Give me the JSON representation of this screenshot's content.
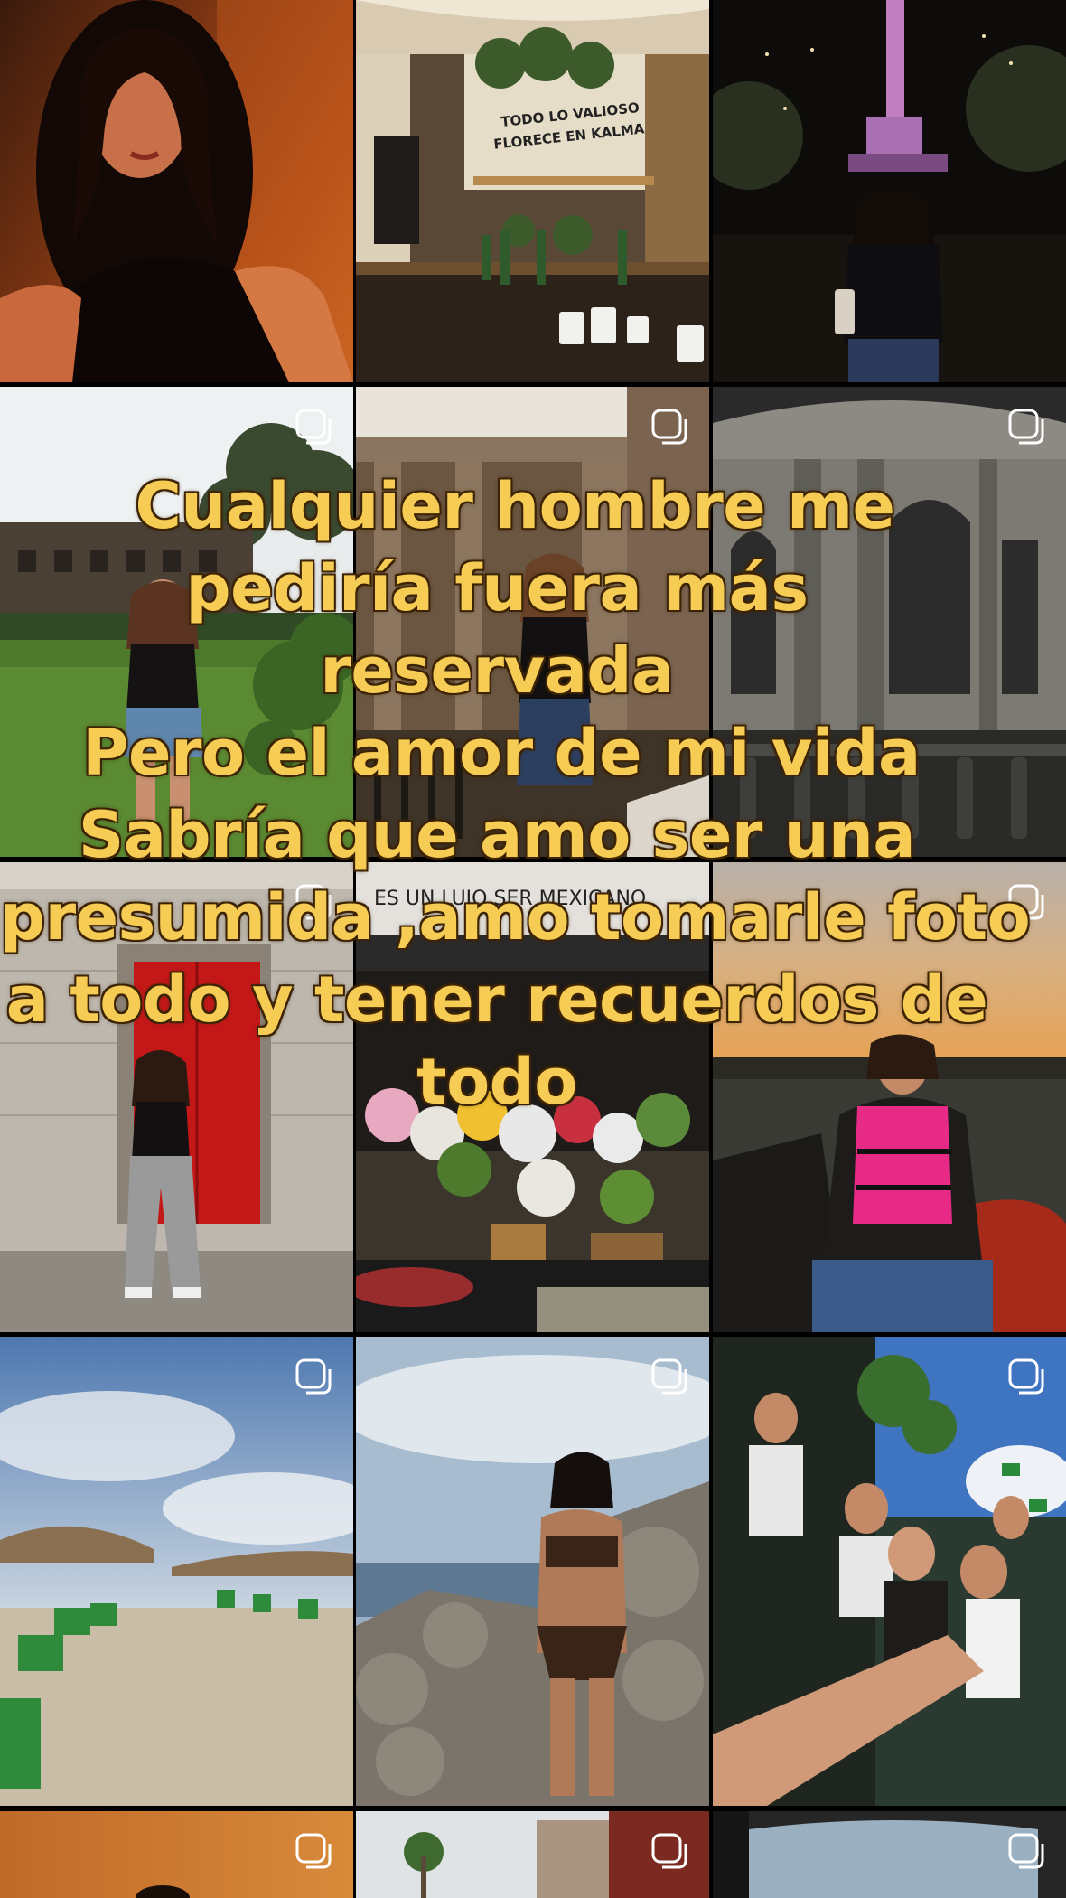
{
  "overlay_caption": {
    "lines": [
      "Cualquier hombre me",
      "pediría fuera más",
      "reservada",
      "Pero el amor de mi vida",
      "Sabría que amo ser una",
      "presumida ,amo tomarle foto",
      "a todo y tener recuerdos de",
      "todo"
    ]
  },
  "signs": {
    "cafe_sign_line1": "TODO LO VALIOSO",
    "cafe_sign_line2": "FLORECE EN KALMA",
    "market_sign": "ES UN LUJO SER MEXICANO"
  },
  "grid": {
    "tiles": [
      {
        "id": "r1c1",
        "subject": "portrait-warm-light",
        "multi": false
      },
      {
        "id": "r1c2",
        "subject": "cafe-interior",
        "multi": false
      },
      {
        "id": "r1c3",
        "subject": "night-monument",
        "multi": false
      },
      {
        "id": "r2c1",
        "subject": "castle-lawn",
        "multi": true
      },
      {
        "id": "r2c2",
        "subject": "colonnade",
        "multi": true
      },
      {
        "id": "r2c3",
        "subject": "palace-facade",
        "multi": true
      },
      {
        "id": "r3c1",
        "subject": "red-door",
        "multi": true
      },
      {
        "id": "r3c2",
        "subject": "flower-market",
        "multi": false
      },
      {
        "id": "r3c3",
        "subject": "boat-sunset",
        "multi": true
      },
      {
        "id": "r4c1",
        "subject": "beach-umbrellas",
        "multi": true
      },
      {
        "id": "r4c2",
        "subject": "beach-rocks",
        "multi": true
      },
      {
        "id": "r4c3",
        "subject": "stadium-selfie",
        "multi": true
      },
      {
        "id": "r5c1",
        "subject": "warm-portrait",
        "multi": true
      },
      {
        "id": "r5c2",
        "subject": "street-palms",
        "multi": true
      },
      {
        "id": "r5c3",
        "subject": "car-interior",
        "multi": true
      }
    ]
  },
  "colors": {
    "caption_fill": "#f6cc55",
    "caption_stroke": "#5a3608",
    "background": "#000000"
  }
}
